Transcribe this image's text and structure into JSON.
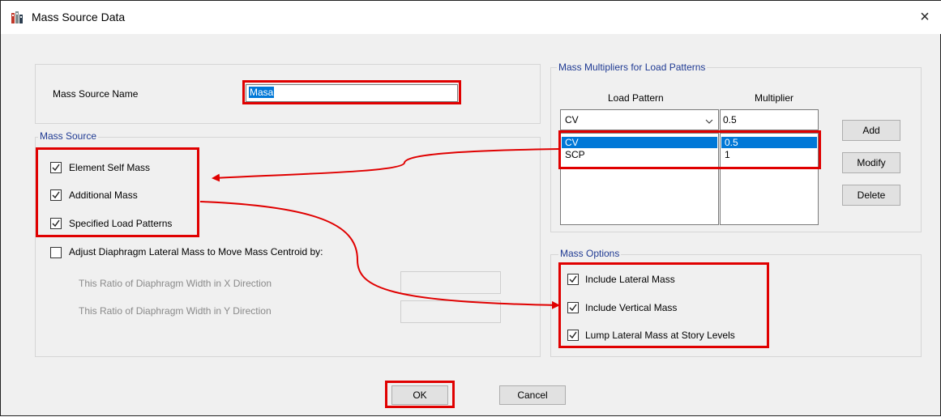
{
  "window": {
    "title": "Mass Source Data",
    "close_glyph": "×",
    "app_icon": "building-icon"
  },
  "name_row": {
    "label": "Mass Source Name",
    "value": "Masa"
  },
  "mass_source": {
    "legend": "Mass Source",
    "options": [
      {
        "label": "Element Self Mass",
        "checked": true
      },
      {
        "label": "Additional Mass",
        "checked": true
      },
      {
        "label": "Specified Load Patterns",
        "checked": true
      }
    ],
    "adjust": {
      "label": "Adjust Diaphragm Lateral Mass to Move Mass Centroid by:",
      "checked": false
    },
    "ratio_x_label": "This Ratio of Diaphragm Width in X Direction",
    "ratio_y_label": "This Ratio of Diaphragm Width in Y Direction",
    "ratio_x_value": "",
    "ratio_y_value": ""
  },
  "multipliers": {
    "legend": "Mass Multipliers for Load Patterns",
    "col_load_pattern": "Load Pattern",
    "col_multiplier": "Multiplier",
    "selected_pattern": "CV",
    "input_multiplier": "0.5",
    "rows": [
      {
        "pattern": "CV",
        "multiplier": "0.5",
        "selected": true
      },
      {
        "pattern": "SCP",
        "multiplier": "1",
        "selected": false
      }
    ],
    "add_label": "Add",
    "modify_label": "Modify",
    "delete_label": "Delete"
  },
  "mass_options": {
    "legend": "Mass Options",
    "options": [
      {
        "label": "Include Lateral Mass",
        "checked": true
      },
      {
        "label": "Include Vertical Mass",
        "checked": true
      },
      {
        "label": "Lump Lateral Mass at Story Levels",
        "checked": true
      }
    ]
  },
  "footer": {
    "ok_label": "OK",
    "cancel_label": "Cancel"
  },
  "colors": {
    "highlight": "#e00000",
    "selection": "#0078d7",
    "legend_text": "#1f3a93"
  }
}
